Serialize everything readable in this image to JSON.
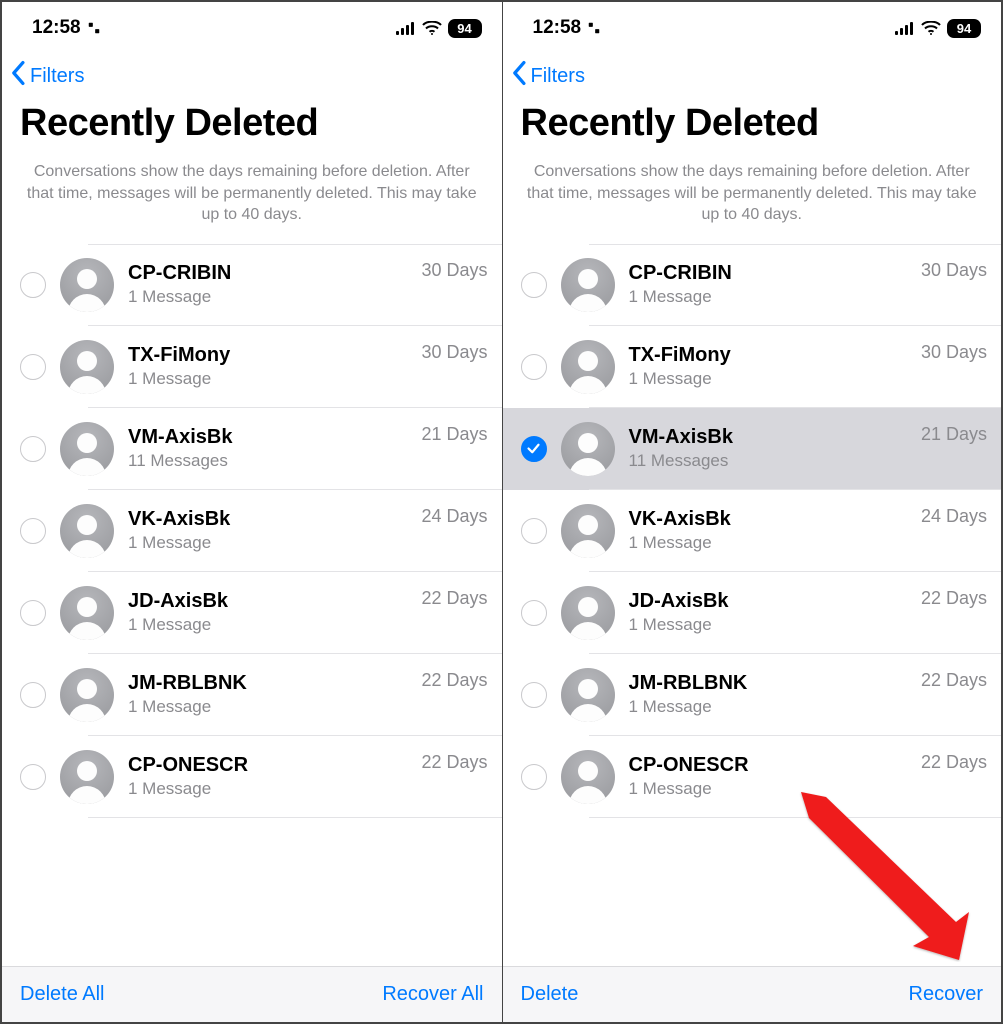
{
  "status": {
    "time": "12:58",
    "battery": "94"
  },
  "nav": {
    "back_label": "Filters"
  },
  "page": {
    "title": "Recently Deleted",
    "description": "Conversations show the days remaining before deletion. After that time, messages will be permanently deleted. This may take up to 40 days."
  },
  "screens": [
    {
      "toolbar": {
        "left": "Delete All",
        "right": "Recover All"
      },
      "rows": [
        {
          "name": "CP-CRIBIN",
          "sub": "1 Message",
          "days": "30 Days",
          "selected": false
        },
        {
          "name": "TX-FiMony",
          "sub": "1 Message",
          "days": "30 Days",
          "selected": false
        },
        {
          "name": "VM-AxisBk",
          "sub": "11 Messages",
          "days": "21 Days",
          "selected": false
        },
        {
          "name": "VK-AxisBk",
          "sub": "1 Message",
          "days": "24 Days",
          "selected": false
        },
        {
          "name": "JD-AxisBk",
          "sub": "1 Message",
          "days": "22 Days",
          "selected": false
        },
        {
          "name": "JM-RBLBNK",
          "sub": "1 Message",
          "days": "22 Days",
          "selected": false
        },
        {
          "name": "CP-ONESCR",
          "sub": "1 Message",
          "days": "22 Days",
          "selected": false
        }
      ]
    },
    {
      "toolbar": {
        "left": "Delete",
        "right": "Recover"
      },
      "rows": [
        {
          "name": "CP-CRIBIN",
          "sub": "1 Message",
          "days": "30 Days",
          "selected": false
        },
        {
          "name": "TX-FiMony",
          "sub": "1 Message",
          "days": "30 Days",
          "selected": false
        },
        {
          "name": "VM-AxisBk",
          "sub": "11 Messages",
          "days": "21 Days",
          "selected": true
        },
        {
          "name": "VK-AxisBk",
          "sub": "1 Message",
          "days": "24 Days",
          "selected": false
        },
        {
          "name": "JD-AxisBk",
          "sub": "1 Message",
          "days": "22 Days",
          "selected": false
        },
        {
          "name": "JM-RBLBNK",
          "sub": "1 Message",
          "days": "22 Days",
          "selected": false
        },
        {
          "name": "CP-ONESCR",
          "sub": "1 Message",
          "days": "22 Days",
          "selected": false
        }
      ]
    }
  ]
}
